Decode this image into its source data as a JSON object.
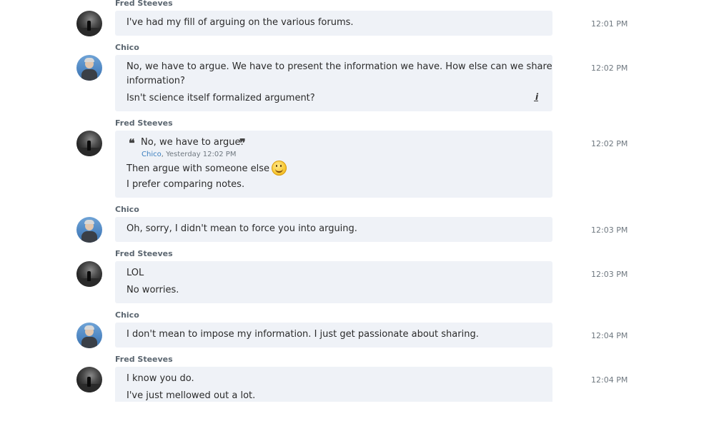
{
  "conversation": {
    "messages": [
      {
        "sender": "Fred Steeves",
        "avatar": "fred-avatar",
        "time": "12:01 PM",
        "lines": [
          "I've had my fill of arguing on the various forums."
        ]
      },
      {
        "sender": "Chico",
        "avatar": "chico-avatar",
        "time": "12:02 PM",
        "lines": [
          "No, we have to argue.  We have to present the information we have.  How else can we share",
          "information?",
          "Isn't science itself formalized argument?"
        ],
        "edited_icon": "edited-icon"
      },
      {
        "sender": "Fred Steeves",
        "avatar": "fred-avatar",
        "time": "12:02 PM",
        "quote": {
          "text": "No, we have to argue.",
          "author": "Chico",
          "timestamp": ", Yesterday 12:02 PM"
        },
        "lines": [
          "Then argue with someone else",
          "I prefer comparing notes."
        ],
        "emoji": "smile-emoji"
      },
      {
        "sender": "Chico",
        "avatar": "chico-avatar",
        "time": "12:03 PM",
        "lines": [
          "Oh, sorry, I didn't mean to force you into arguing."
        ]
      },
      {
        "sender": "Fred Steeves",
        "avatar": "fred-avatar",
        "time": "12:03 PM",
        "lines": [
          "LOL",
          "No worries."
        ]
      },
      {
        "sender": "Chico",
        "avatar": "chico-avatar",
        "time": "12:04 PM",
        "lines": [
          "I don't mean to impose my information.  I just get passionate about sharing."
        ]
      },
      {
        "sender": "Fred Steeves",
        "avatar": "fred-avatar",
        "time": "12:04 PM",
        "lines": [
          "I know you do.",
          "I've just mellowed out a lot."
        ]
      }
    ]
  },
  "colors": {
    "bubble": "#eff2f7",
    "sender": "#5b6670",
    "timestamp": "#6f7880",
    "quote_author": "#3a7ebf"
  }
}
